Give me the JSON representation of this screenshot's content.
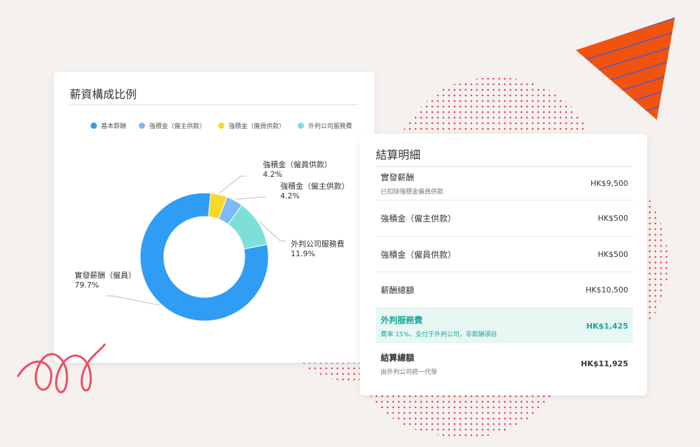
{
  "colors": {
    "base": "#2f9df4",
    "employer": "#7dbaf7",
    "employee": "#f8d82a",
    "outsource": "#7de0d8",
    "accent": "#1fa596",
    "triangle": "#f1530f"
  },
  "chart_card": {
    "title": "薪資構成比例",
    "legend": [
      {
        "label": "基本薪酬",
        "color": "#2f9df4"
      },
      {
        "label": "強積金（僱主供款）",
        "color": "#7dbaf7"
      },
      {
        "label": "強積金（僱員供款）",
        "color": "#f8d82a"
      },
      {
        "label": "外判公司服務費",
        "color": "#7de0d8"
      }
    ]
  },
  "chart_data": {
    "type": "pie",
    "title": "薪資構成比例",
    "series": [
      {
        "name": "實發薪酬（僱員）",
        "value": 79.7,
        "label_pct": "79.7%",
        "color": "#2f9df4"
      },
      {
        "name": "強積金（僱員供款）",
        "value": 4.2,
        "label_pct": "4.2%",
        "color": "#f8d82a"
      },
      {
        "name": "強積金（僱主供款）",
        "value": 4.2,
        "label_pct": "4.2%",
        "color": "#7dbaf7"
      },
      {
        "name": "外判公司服務費",
        "value": 11.9,
        "label_pct": "11.9%",
        "color": "#7de0d8"
      }
    ]
  },
  "detail_card": {
    "title": "結算明細",
    "rows": [
      {
        "label": "實發薪酬",
        "sub": "已扣除強積金僱員供款",
        "value": "HK$9,500"
      },
      {
        "label": "強積金（僱主供款）",
        "sub": "",
        "value": "HK$500"
      },
      {
        "label": "強積金（僱員供款）",
        "sub": "",
        "value": "HK$500"
      },
      {
        "label": "薪酬總額",
        "sub": "",
        "value": "HK$10,500"
      },
      {
        "label": "外判服務費",
        "sub": "費率 15%，支付于外判公司，非薪酬項目",
        "value": "HK$1,425"
      },
      {
        "label": "結算總額",
        "sub": "由外判公司統一代發",
        "value": "HK$11,925"
      }
    ]
  }
}
